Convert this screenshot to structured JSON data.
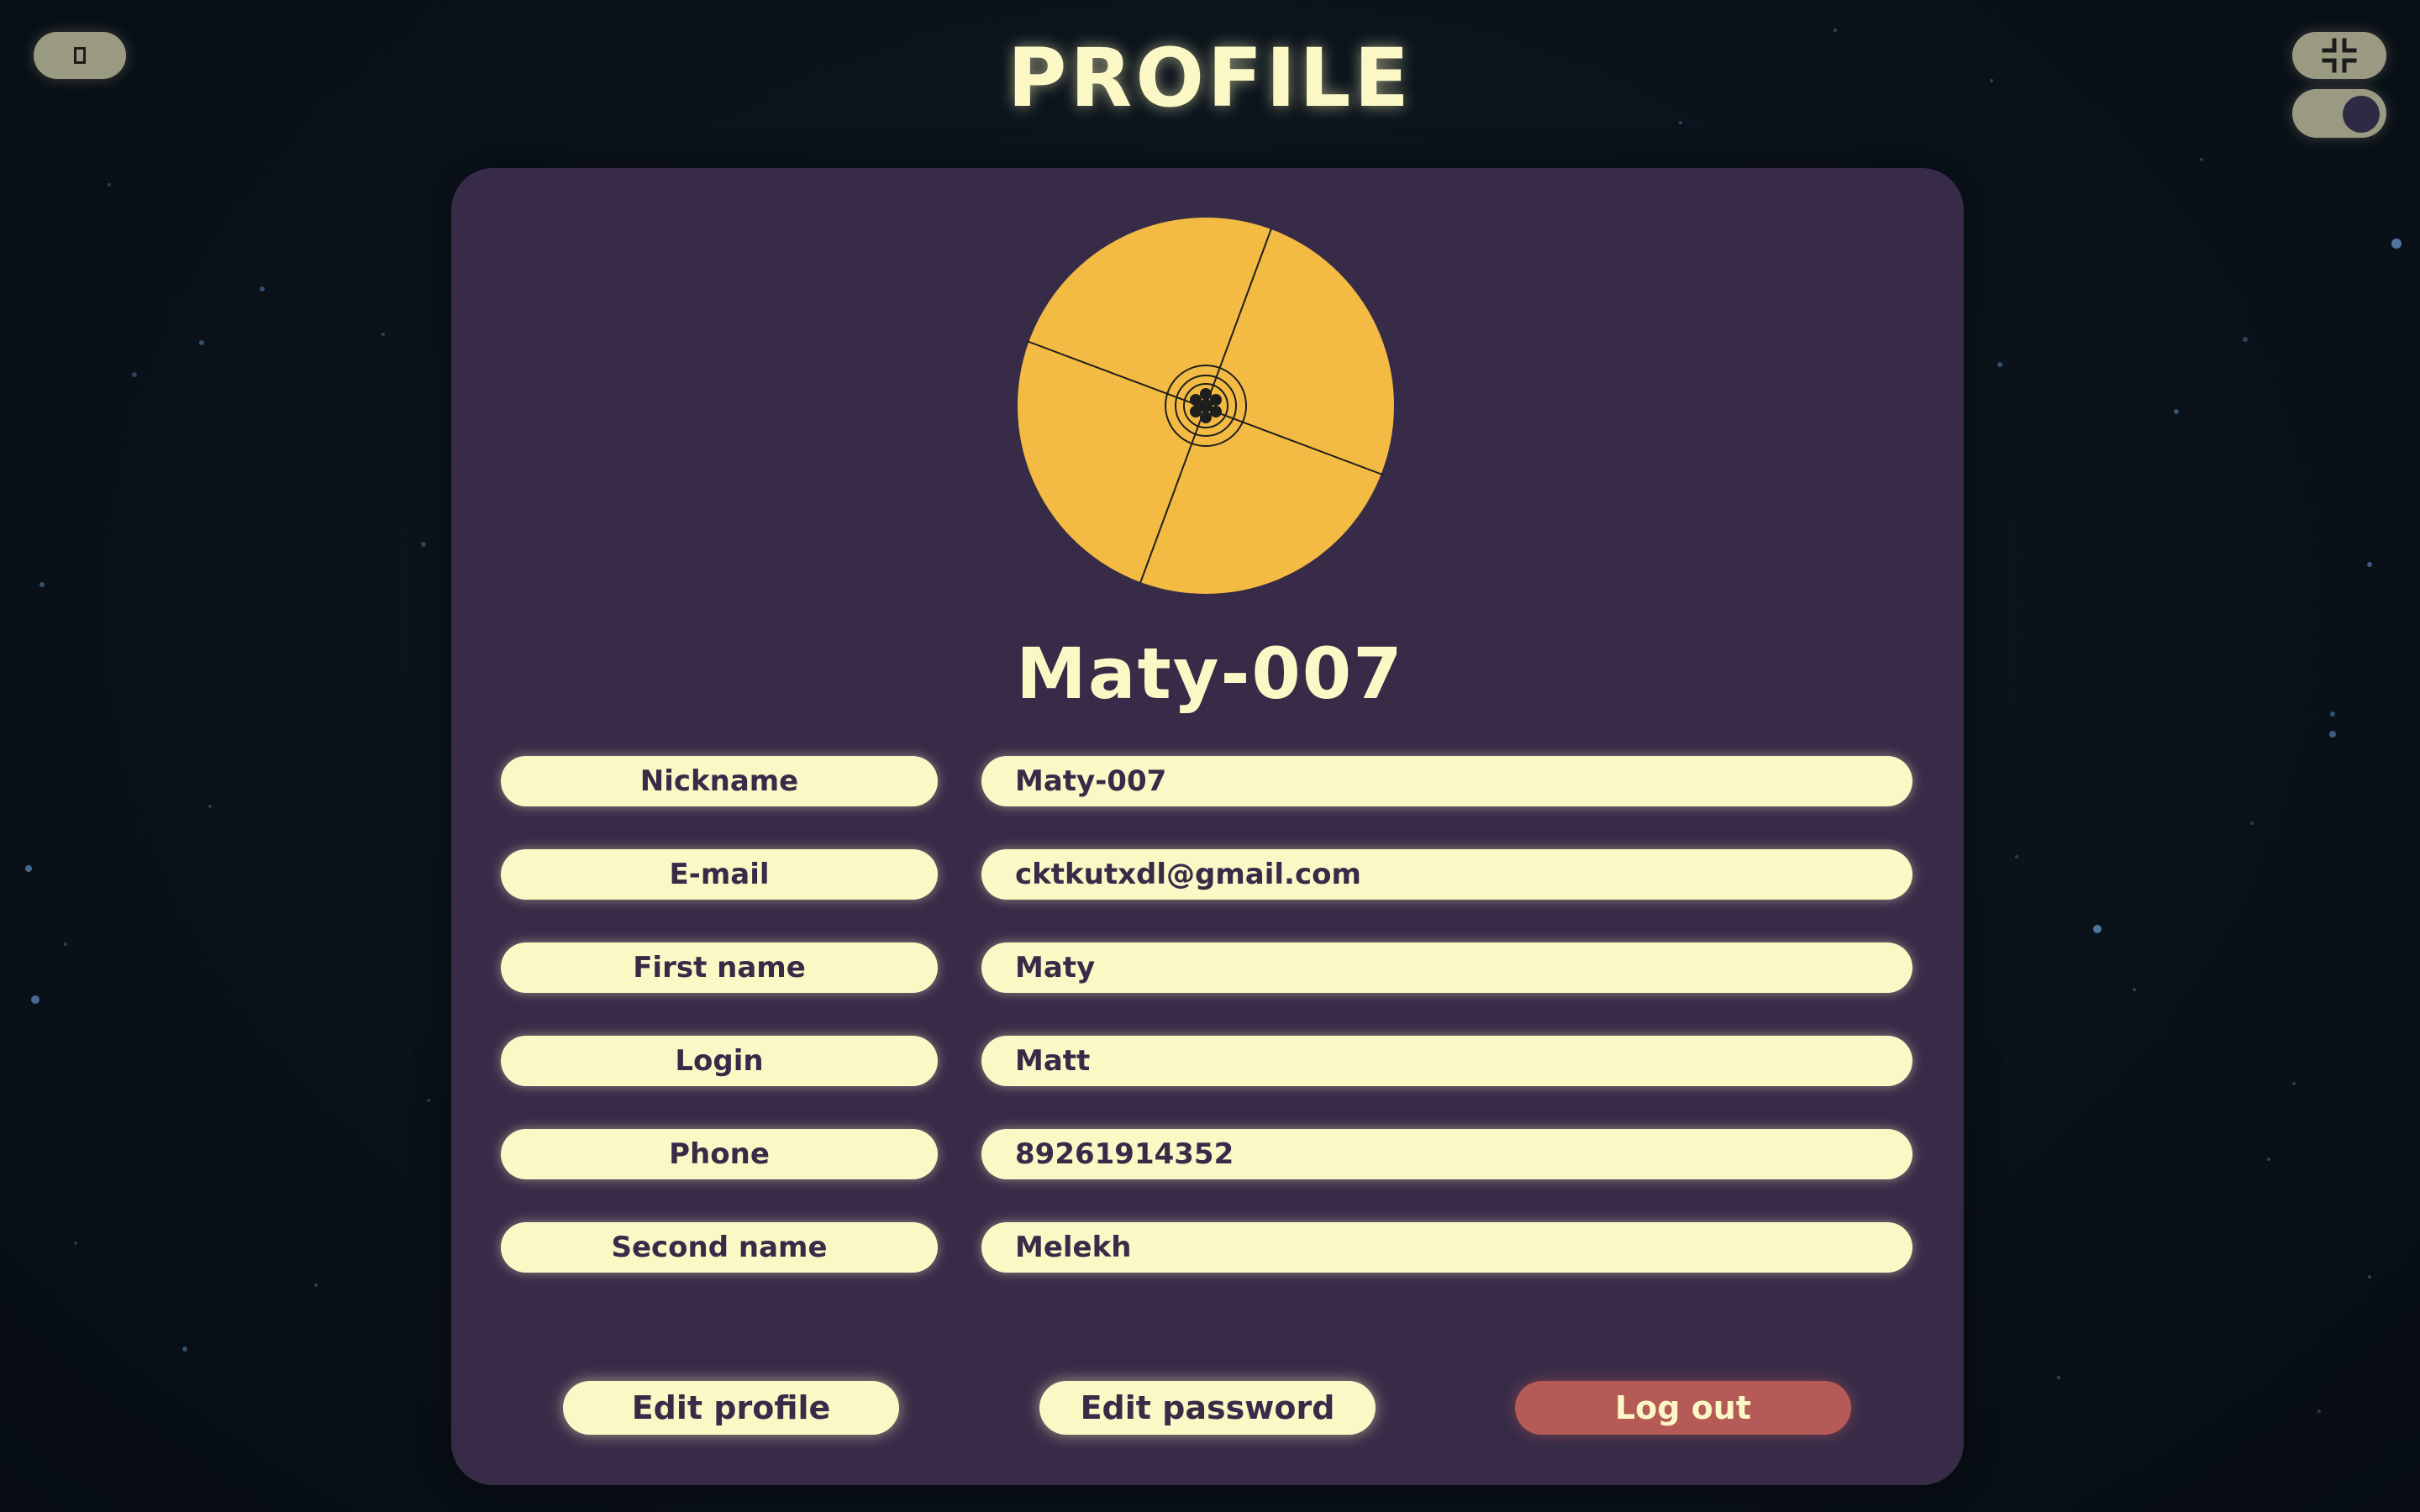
{
  "page": {
    "title": "PROFILE"
  },
  "controls": {
    "menu_icon": "rectangle-icon",
    "fullscreen_icon": "collapse-fullscreen-icon",
    "theme_toggle": "toggle-icon"
  },
  "profile": {
    "username": "Maty-007",
    "fields": [
      {
        "label": "Nickname",
        "value": "Maty-007"
      },
      {
        "label": "E-mail",
        "value": "cktkutxdl@gmail.com"
      },
      {
        "label": "First name",
        "value": "Maty"
      },
      {
        "label": "Login",
        "value": "Matt"
      },
      {
        "label": "Phone",
        "value": "89261914352"
      },
      {
        "label": "Second name",
        "value": "Melekh"
      }
    ]
  },
  "actions": {
    "edit_profile": "Edit profile",
    "edit_password": "Edit password",
    "logout": "Log out"
  },
  "colors": {
    "card": "#372b48",
    "pill": "#fbf8c6",
    "title": "#fbf8c6",
    "avatar": "#f3bb43",
    "logout": "#b55a56"
  }
}
